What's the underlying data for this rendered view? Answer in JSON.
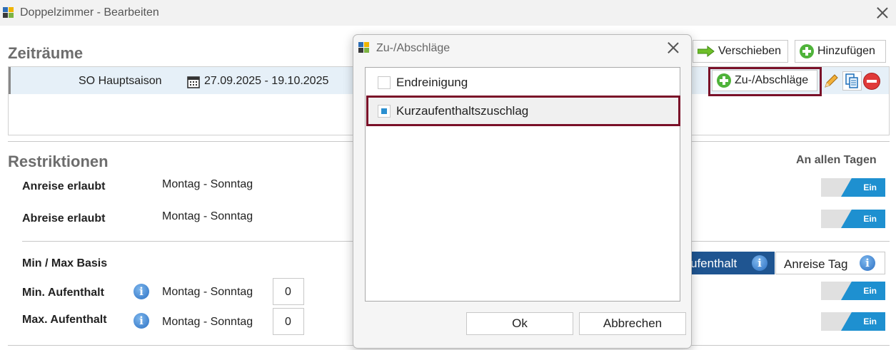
{
  "window": {
    "title": "Doppelzimmer - Bearbeiten"
  },
  "zeitraeume": {
    "section_title": "Zeiträume",
    "buttons": {
      "verschieben": "Verschieben",
      "hinzufuegen": "Hinzufügen",
      "zu_abschlaege": "Zu-/Abschläge"
    },
    "period": {
      "name": "SO Hauptsaison",
      "date_range": "27.09.2025 - 19.10.2025"
    }
  },
  "restriktionen": {
    "section_title": "Restriktionen",
    "an_allen_tagen": "An allen Tagen",
    "toggle_label": "Ein",
    "rows": [
      {
        "label": "Anreise erlaubt",
        "value": "Montag - Sonntag"
      },
      {
        "label": "Abreise erlaubt",
        "value": "Montag - Sonntag"
      }
    ],
    "min_max_basis": {
      "label": "Min / Max Basis",
      "option_selected": "ufenthalt",
      "option_other": "Anreise Tag"
    },
    "stay_rows": [
      {
        "label": "Min. Aufenthalt",
        "days": "Montag - Sonntag",
        "value": "0"
      },
      {
        "label": "Max. Aufenthalt",
        "days": "Montag - Sonntag",
        "value": "0"
      }
    ]
  },
  "dialog": {
    "title": "Zu-/Abschläge",
    "items": [
      {
        "label": "Endreinigung",
        "checked": false
      },
      {
        "label": "Kurzaufenthaltszuschlag",
        "checked": true
      }
    ],
    "ok_label": "Ok",
    "cancel_label": "Abbrechen"
  },
  "colors": {
    "highlight": "#7a1028",
    "toggle_on": "#1e90d0",
    "segment_dark": "#1f5591"
  }
}
